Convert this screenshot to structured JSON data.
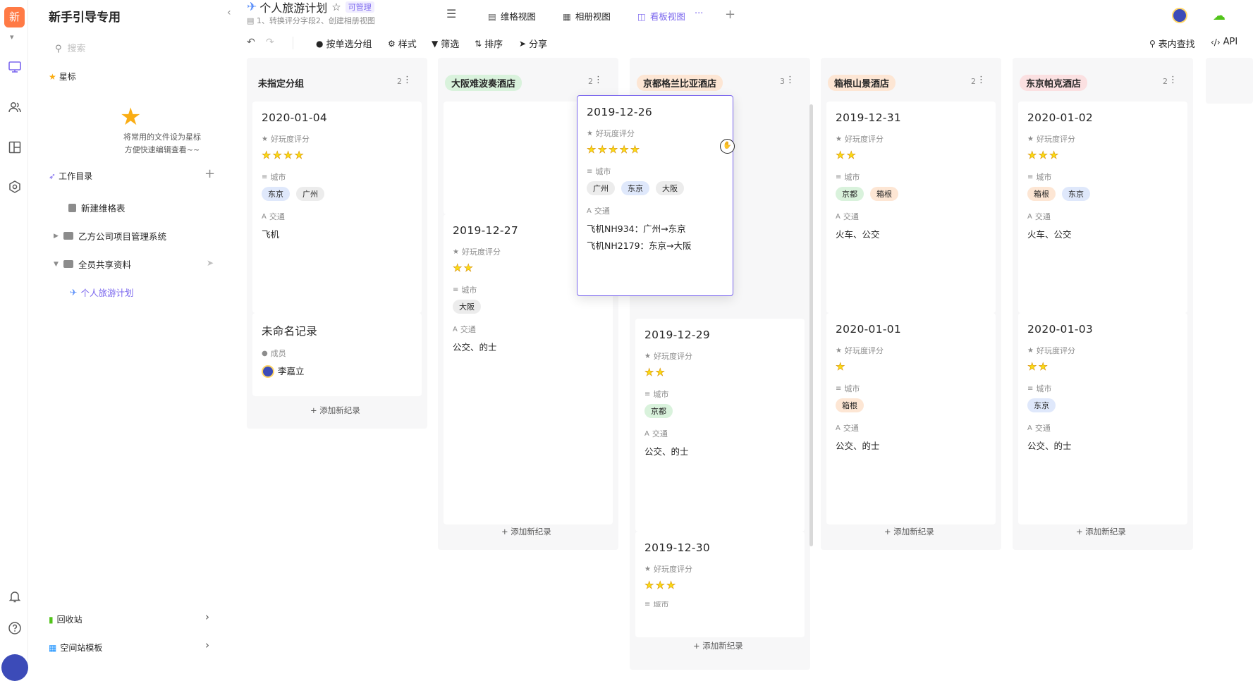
{
  "rail": {
    "logo": "新"
  },
  "sidebar": {
    "space_name": "新手引导专用",
    "search_placeholder": "搜索",
    "starred_heading": "星标",
    "starred_tip_line1": "将常用的文件设为星标",
    "starred_tip_line2": "方便快速编辑查看~~",
    "workdir_heading": "工作目录",
    "tree": [
      {
        "label": "新建维格表"
      },
      {
        "label": "乙方公司项目管理系统"
      },
      {
        "label": "全员共享资料"
      },
      {
        "label": "个人旅游计划"
      }
    ],
    "recycle": "回收站",
    "templates": "空间站模板"
  },
  "header": {
    "title": "个人旅游计划",
    "permission": "可管理",
    "subtitle": "1、转换评分字段2、创建相册视图",
    "views": [
      {
        "label": "维格视图"
      },
      {
        "label": "相册视图"
      },
      {
        "label": "看板视图"
      }
    ]
  },
  "toolbar": {
    "group": "按单选分组",
    "style": "样式",
    "filter": "筛选",
    "sort": "排序",
    "share": "分享",
    "find": "表内查找",
    "api": "API"
  },
  "labels": {
    "rating": "好玩度评分",
    "city": "城市",
    "transport": "交通",
    "member": "成员",
    "add_record": "添加新纪录"
  },
  "columns": [
    {
      "name": "未指定分组",
      "count": "2"
    },
    {
      "name": "大阪难波奏酒店",
      "count": "2",
      "color": "#d9f2dc"
    },
    {
      "name": "京都格兰比亚酒店",
      "count": "3",
      "color": "#fde6d4"
    },
    {
      "name": "箱根山景酒店",
      "count": "2",
      "color": "#fde6d4"
    },
    {
      "name": "东京帕克酒店",
      "count": "2",
      "color": "#fbe0e1"
    }
  ],
  "cards": {
    "c1": {
      "date": "2020-01-04",
      "rating": 4,
      "cities": [
        "东京",
        "广州"
      ],
      "transport": "飞机"
    },
    "c2": {
      "name": "未命名记录",
      "member": "李嘉立"
    },
    "c3": {
      "date": "2019-12-27",
      "rating": 2,
      "cities": [
        "大阪"
      ],
      "transport": "公交、的士"
    },
    "c4": {
      "date": "2019-12-26",
      "rating": 5,
      "cities": [
        "广州",
        "东京",
        "大阪"
      ],
      "transport_line1": "飞机NH934：广州→东京",
      "transport_line2": "飞机NH2179：东京→大阪"
    },
    "c5": {
      "date": "2019-12-29",
      "rating": 2,
      "cities": [
        "京都"
      ],
      "transport": "公交、的士"
    },
    "c6": {
      "date": "2019-12-30",
      "rating": 3
    },
    "c7": {
      "date": "2019-12-31",
      "rating": 2,
      "cities": [
        "京都",
        "箱根"
      ],
      "transport": "火车、公交"
    },
    "c8": {
      "date": "2020-01-01",
      "rating": 1,
      "cities": [
        "箱根"
      ],
      "transport": "公交、的士"
    },
    "c9": {
      "date": "2020-01-02",
      "rating": 3,
      "cities": [
        "箱根",
        "东京"
      ],
      "transport": "火车、公交"
    },
    "c10": {
      "date": "2020-01-03",
      "rating": 2,
      "cities": [
        "东京"
      ],
      "transport": "公交、的士"
    }
  },
  "city_colors": {
    "东京": "#dfe8fb",
    "广州": "#ececec",
    "大阪": "#ececec",
    "京都": "#d9f2dc",
    "箱根": "#fde6d4"
  }
}
